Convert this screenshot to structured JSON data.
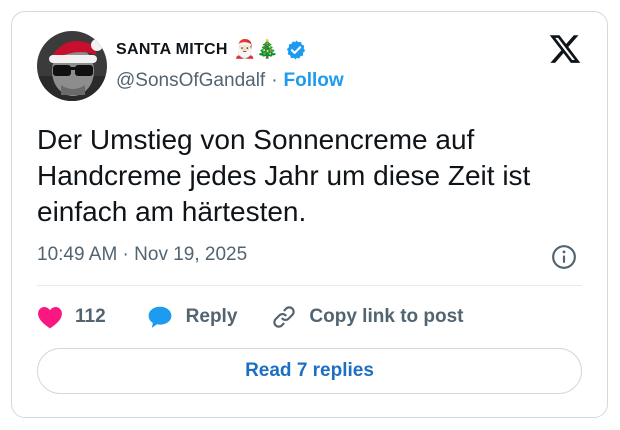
{
  "author": {
    "display_name": "SANTA MITCH",
    "emojis": "🎅🏻🎄",
    "handle": "@SonsOfGandalf",
    "separator": "·",
    "follow_label": "Follow",
    "verified": true
  },
  "tweet": {
    "text": "Der Umstieg von Sonnencreme auf Handcreme jedes Jahr um diese Zeit ist einfach am härtesten.",
    "timestamp": "10:49 AM · Nov 19, 2025"
  },
  "actions": {
    "like_count": "112",
    "reply_label": "Reply",
    "copy_label": "Copy link to post"
  },
  "footer": {
    "read_replies_label": "Read 7 replies"
  },
  "icons": {
    "brand": "x-logo-icon",
    "verified": "verified-badge-icon",
    "info": "info-icon",
    "like": "heart-icon",
    "reply": "speech-bubble-icon",
    "copy": "link-icon"
  },
  "colors": {
    "accent": "#1d9bf0",
    "like": "#f91880",
    "text": "#0f1419",
    "muted": "#536471",
    "border": "#cfd9de"
  }
}
